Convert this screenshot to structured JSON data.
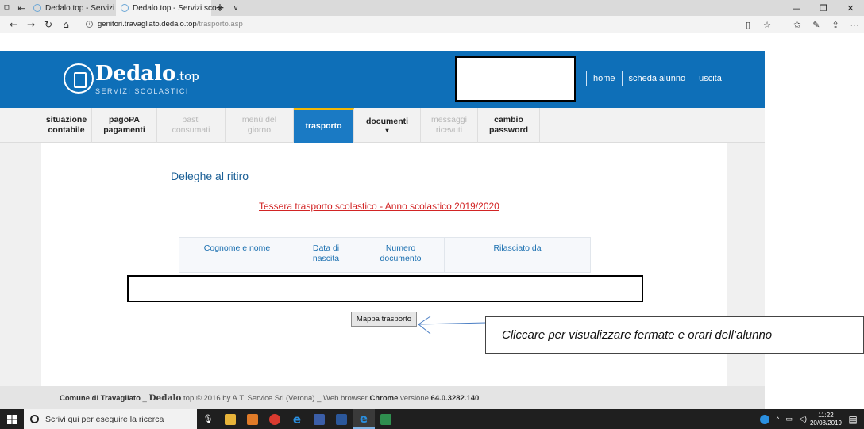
{
  "browser": {
    "tabs": [
      {
        "title": "Dedalo.top - Servizi scolasti",
        "active": false
      },
      {
        "title": "Dedalo.top - Servizi sco",
        "active": true
      }
    ],
    "new_tab": "+",
    "tab_menu": "∨",
    "url_host": "genitori.travagliato.dedalo.top",
    "url_path": "/trasporto.asp"
  },
  "header": {
    "logo_name": "Dedalo",
    "logo_tld": ".top",
    "logo_sub": "SERVIZI SCOLASTICI",
    "nav": [
      "home",
      "scheda alunno",
      "uscita"
    ]
  },
  "menu": [
    {
      "line1": "situazione",
      "line2": "contabile",
      "state": "normal"
    },
    {
      "line1": "pagoPA",
      "line2": "pagamenti",
      "state": "normal"
    },
    {
      "line1": "pasti",
      "line2": "consumati",
      "state": "disabled"
    },
    {
      "line1": "menù del",
      "line2": "giorno",
      "state": "disabled"
    },
    {
      "line1": "trasporto",
      "line2": "",
      "state": "active"
    },
    {
      "line1": "documenti",
      "line2": "▾",
      "state": "normal"
    },
    {
      "line1": "messaggi",
      "line2": "ricevuti",
      "state": "disabled"
    },
    {
      "line1": "cambio",
      "line2": "password",
      "state": "normal"
    }
  ],
  "main": {
    "title": "Deleghe al ritiro",
    "subtitle": "Tessera trasporto scolastico - Anno scolastico 2019/2020",
    "table_headers": [
      {
        "line1": "Cognome e nome",
        "line2": ""
      },
      {
        "line1": "Data di",
        "line2": "nascita"
      },
      {
        "line1": "Numero",
        "line2": "documento"
      },
      {
        "line1": "Rilasciato da",
        "line2": ""
      }
    ],
    "map_button": "Mappa trasporto",
    "callout": "Cliccare per visualizzare fermate e orari  dell’alunno"
  },
  "footer": {
    "comune": "Comune di Travagliato",
    "sep1": " _ ",
    "brand": "Dedalo",
    "brand_tld": ".top",
    "copyright": " © 2016 by A.T. Service Srl (Verona) _ Web browser ",
    "browser_name": "Chrome",
    "version_text": " versione ",
    "version": "64.0.3282.140"
  },
  "taskbar": {
    "search_placeholder": "Scrivi qui per eseguire la ricerca",
    "time": "11:22",
    "date": "20/08/2019"
  },
  "colors": {
    "brand_blue": "#0e6fb8",
    "active_tab": "#1a7ac4",
    "accent_yellow": "#f2b705",
    "subtitle_red": "#d22424"
  }
}
